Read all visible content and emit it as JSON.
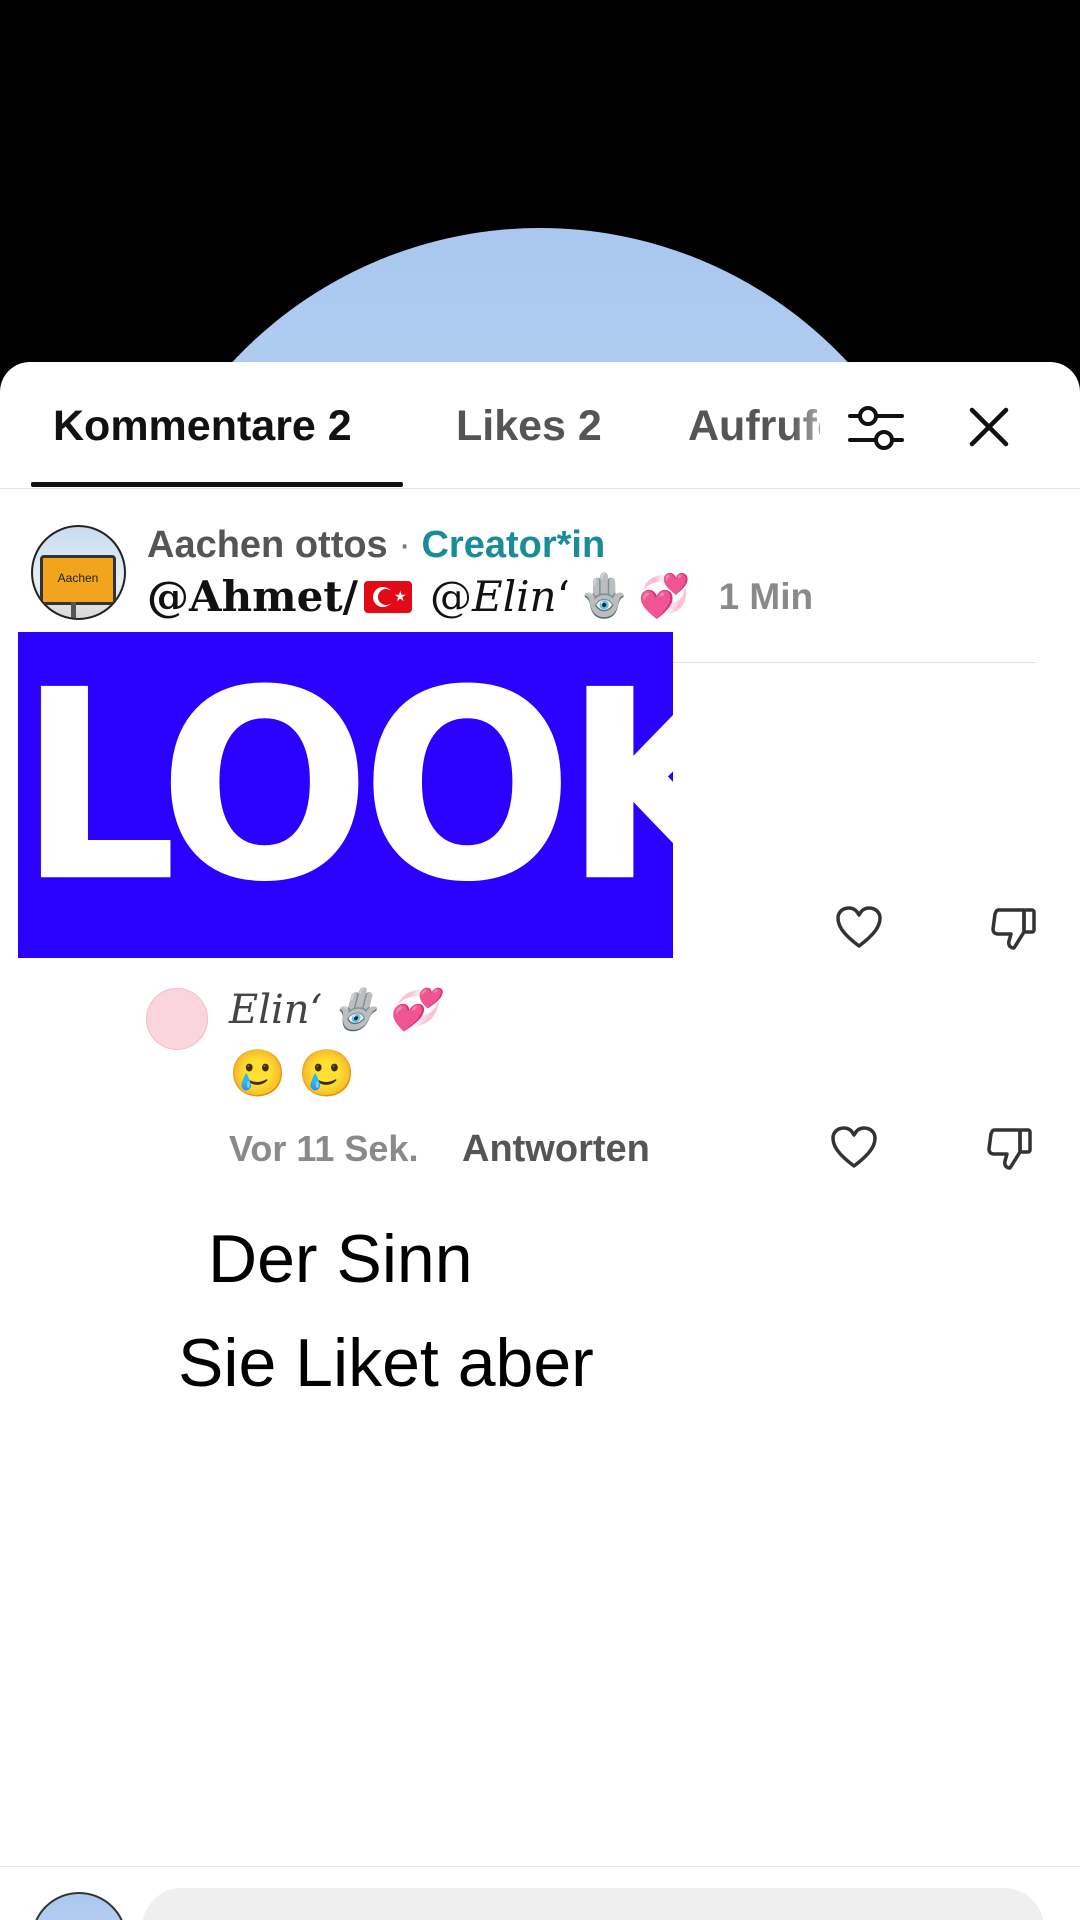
{
  "tabs": {
    "comments_label": "Kommentare 2",
    "likes_label": "Likes 2",
    "views_label": "Aufrufe"
  },
  "icons": {
    "filter": "sliders-icon",
    "close": "close-icon",
    "like": "heart-outline-icon",
    "dislike": "thumbs-down-outline-icon"
  },
  "comment": {
    "author": "Aachen ottos",
    "separator": " · ",
    "badge": "Creator*in",
    "avatar_sign_text": "Aachen",
    "mention_1": "@Ahmet/",
    "mention_2_prefix": "@",
    "mention_2_name": "Elin",
    "mention_2_mark": "ʻ",
    "emoji_hand": "🪬",
    "emoji_hearts": "💞",
    "time": "1 Min",
    "image_text": "LOOK"
  },
  "reply": {
    "name": "Elin",
    "name_mark": "ʻ",
    "emoji_hand": "🪬",
    "emoji_hearts": "💞",
    "text_emoji_1": "🥲",
    "text_emoji_2": "🥲",
    "time": "Vor 11 Sek.",
    "reply_label": "Antworten"
  },
  "overlay": {
    "line_1": "Der Sinn",
    "line_2": "Sie Liket aber"
  },
  "colors": {
    "creator_badge": "#1a8c98",
    "image_background": "#2a00ff",
    "flag_red": "#e30a17"
  }
}
